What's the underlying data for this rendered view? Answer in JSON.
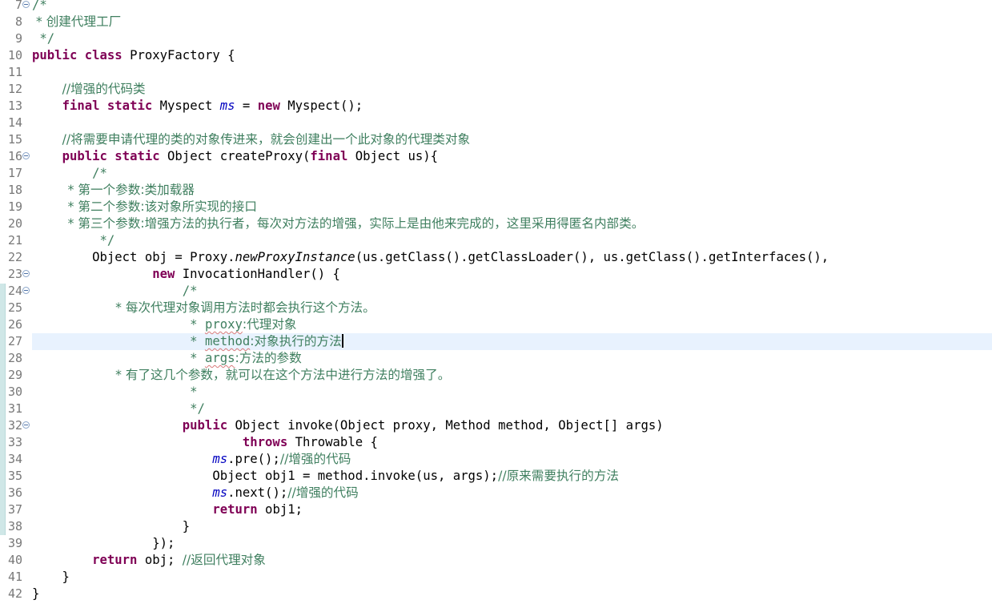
{
  "editor": {
    "lines": [
      {
        "num": "7",
        "fold": true,
        "t": [
          "/*"
        ]
      },
      {
        "num": "8",
        "fold": false,
        "t": [
          " * 创建代理工厂"
        ]
      },
      {
        "num": "9",
        "fold": false,
        "t": [
          " */"
        ]
      },
      {
        "num": "10",
        "fold": false,
        "t": [
          "public",
          " ",
          "class",
          " ProxyFactory {"
        ]
      },
      {
        "num": "11",
        "fold": false,
        "t": []
      },
      {
        "num": "12",
        "fold": false,
        "t": [
          "    ",
          "//增强的代码类"
        ]
      },
      {
        "num": "13",
        "fold": false,
        "t": [
          "    ",
          "final",
          " ",
          "static",
          " Myspect ",
          "ms",
          " = ",
          "new",
          " Myspect();"
        ]
      },
      {
        "num": "14",
        "fold": false,
        "t": []
      },
      {
        "num": "15",
        "fold": false,
        "t": [
          "    ",
          "//将需要申请代理的类的对象传进来，就会创建出一个此对象的代理类对象"
        ]
      },
      {
        "num": "16",
        "fold": true,
        "t": [
          "    ",
          "public",
          " ",
          "static",
          " Object createProxy(",
          "final",
          " Object us){"
        ]
      },
      {
        "num": "17",
        "fold": false,
        "t": [
          "        ",
          "/*"
        ]
      },
      {
        "num": "18",
        "fold": false,
        "t": [
          "         * 第一个参数:类加载器"
        ]
      },
      {
        "num": "19",
        "fold": false,
        "t": [
          "         * 第二个参数:该对象所实现的接口"
        ]
      },
      {
        "num": "20",
        "fold": false,
        "t": [
          "         * 第三个参数:增强方法的执行者，每次对方法的增强，实际上是由他来完成的，这里采用得匿名内部类。"
        ]
      },
      {
        "num": "21",
        "fold": false,
        "t": [
          "         */"
        ]
      },
      {
        "num": "22",
        "fold": false,
        "t": [
          "        Object obj = Proxy.",
          "newProxyInstance",
          "(us.getClass().getClassLoader(), us.getClass().getInterfaces(),"
        ]
      },
      {
        "num": "23",
        "fold": true,
        "t": [
          "                ",
          "new",
          " InvocationHandler() {"
        ]
      },
      {
        "num": "24",
        "fold": true,
        "t": [
          "                    ",
          "/*"
        ]
      },
      {
        "num": "25",
        "fold": false,
        "t": [
          "                     * 每次代理对象调用方法时都会执行这个方法。"
        ]
      },
      {
        "num": "26",
        "fold": false,
        "t": [
          "                     * ",
          "proxy",
          ":代理对象"
        ]
      },
      {
        "num": "27",
        "fold": false,
        "t": [
          "                     * ",
          "method",
          ":对象执行的方法"
        ]
      },
      {
        "num": "28",
        "fold": false,
        "t": [
          "                     * ",
          "args",
          ":方法的参数"
        ]
      },
      {
        "num": "29",
        "fold": false,
        "t": [
          "                     * 有了这几个参数，就可以在这个方法中进行方法的增强了。"
        ]
      },
      {
        "num": "30",
        "fold": false,
        "t": [
          "                     *"
        ]
      },
      {
        "num": "31",
        "fold": false,
        "t": [
          "                     */"
        ]
      },
      {
        "num": "32",
        "fold": true,
        "t": [
          "                    ",
          "public",
          " Object invoke(Object proxy, Method method, Object[] args)"
        ]
      },
      {
        "num": "33",
        "fold": false,
        "t": [
          "                            ",
          "throws",
          " Throwable {"
        ]
      },
      {
        "num": "34",
        "fold": false,
        "t": [
          "                        ",
          "ms",
          ".pre();",
          "//增强的代码"
        ]
      },
      {
        "num": "35",
        "fold": false,
        "t": [
          "                        Object obj1 = method.invoke(us, args);",
          "//原来需要执行的方法"
        ]
      },
      {
        "num": "36",
        "fold": false,
        "t": [
          "                        ",
          "ms",
          ".next();",
          "//增强的代码"
        ]
      },
      {
        "num": "37",
        "fold": false,
        "t": [
          "                        ",
          "return",
          " obj1;"
        ]
      },
      {
        "num": "38",
        "fold": false,
        "t": [
          "                    }"
        ]
      },
      {
        "num": "39",
        "fold": false,
        "t": [
          "                });"
        ]
      },
      {
        "num": "40",
        "fold": false,
        "t": [
          "        ",
          "return",
          " obj; ",
          "//返回代理对象"
        ]
      },
      {
        "num": "41",
        "fold": false,
        "t": [
          "    }"
        ]
      },
      {
        "num": "42",
        "fold": false,
        "t": [
          "}"
        ]
      }
    ],
    "current_line": "27",
    "colors": {
      "keyword": "#7f0055",
      "comment": "#3f7f5f",
      "field": "#0000c0",
      "line_number": "#787878",
      "current_line_bg": "#e8f2fe"
    }
  }
}
